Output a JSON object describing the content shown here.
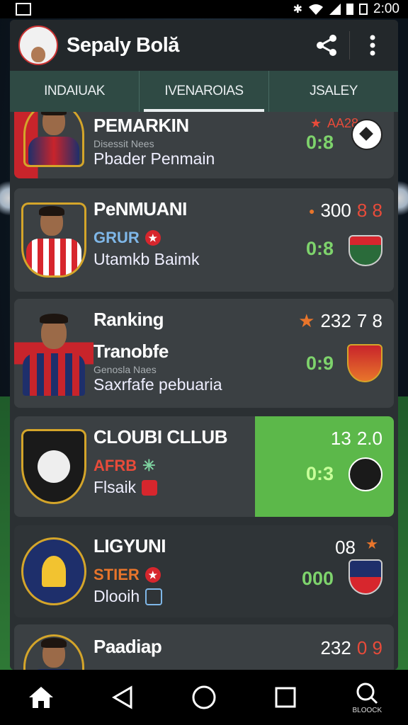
{
  "status_bar": {
    "time": "2:00"
  },
  "app": {
    "title": "Sepaly Bolă"
  },
  "tabs": [
    {
      "label": "INDAIUAK",
      "active": false
    },
    {
      "label": "IVENAROIAS",
      "active": true
    },
    {
      "label": "JSALEY",
      "active": false
    }
  ],
  "cards": [
    {
      "name": "PEMARKIN",
      "sub1": "Disessit Nees",
      "sub2": "Pbader Penmain",
      "top": "AA28",
      "score": "0:8"
    },
    {
      "name": "PeNMUANI",
      "badge": "GRUR",
      "sub2": "Utamkb Baimk",
      "top": "300",
      "top2": "8 8",
      "score": "0:8"
    },
    {
      "name": "Ranking",
      "sub1_title": "Tranobfe",
      "sub1": "Genosla Naes",
      "sub2": "Saxrfafe pebuaria",
      "top": "232",
      "top2": "7 8",
      "score": "0:9"
    },
    {
      "name": "CLOUBI CLLUB",
      "badge": "AFRB",
      "sub2": "Flsaik",
      "top": "13",
      "top2": "2.0",
      "score": "0:3",
      "highlight_color": "#5cb84a"
    },
    {
      "name": "LIGYUNI",
      "badge": "STIER",
      "sub2": "Dlooih",
      "top": "08",
      "score": "000"
    },
    {
      "name": "Paadiap",
      "top": "232",
      "top2": "0 9"
    }
  ],
  "nav": {
    "search_label": "BLOOCK"
  },
  "colors": {
    "accent_green": "#7ed36c",
    "tab_bg": "#2f4a44",
    "star": "#e8752b"
  }
}
